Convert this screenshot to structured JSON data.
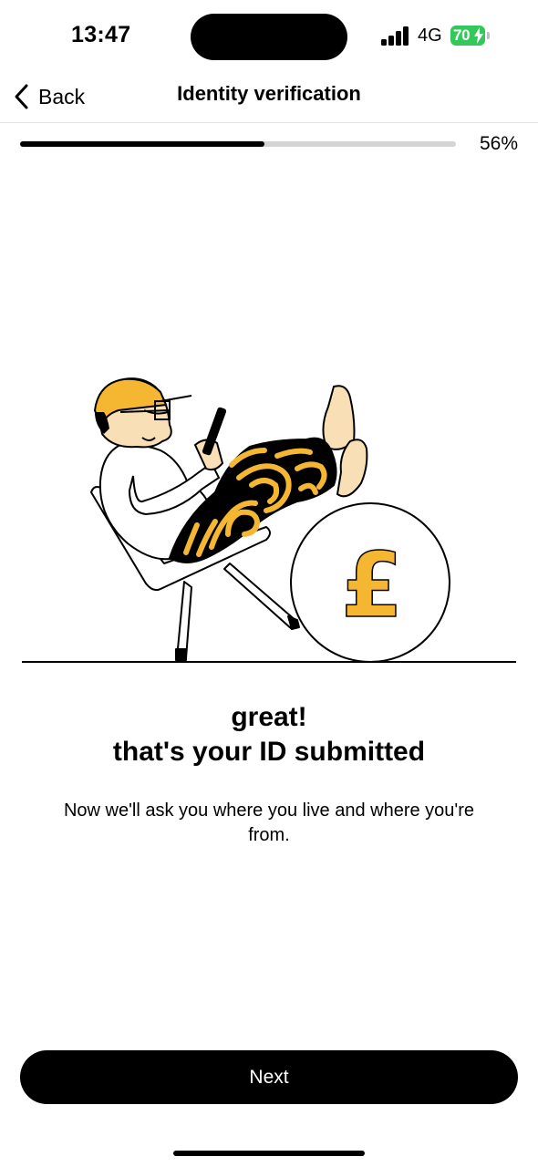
{
  "status_bar": {
    "time": "13:47",
    "network": "4G",
    "battery_level": "70",
    "battery_color": "#34c759",
    "icons": [
      "signal-icon",
      "charging-bolt-icon"
    ]
  },
  "nav": {
    "back_label": "Back",
    "back_icon": "chevron-left-icon",
    "title": "Identity verification"
  },
  "progress": {
    "percent": 56,
    "label": "56%"
  },
  "illustration": {
    "symbol": "£",
    "accent_color": "#f5b731",
    "skin_color": "#f8dfb6"
  },
  "content": {
    "headline_line1": "great!",
    "headline_line2": "that's your ID submitted",
    "subtext": "Now we'll ask you where you live and where you're from."
  },
  "actions": {
    "next_label": "Next"
  }
}
